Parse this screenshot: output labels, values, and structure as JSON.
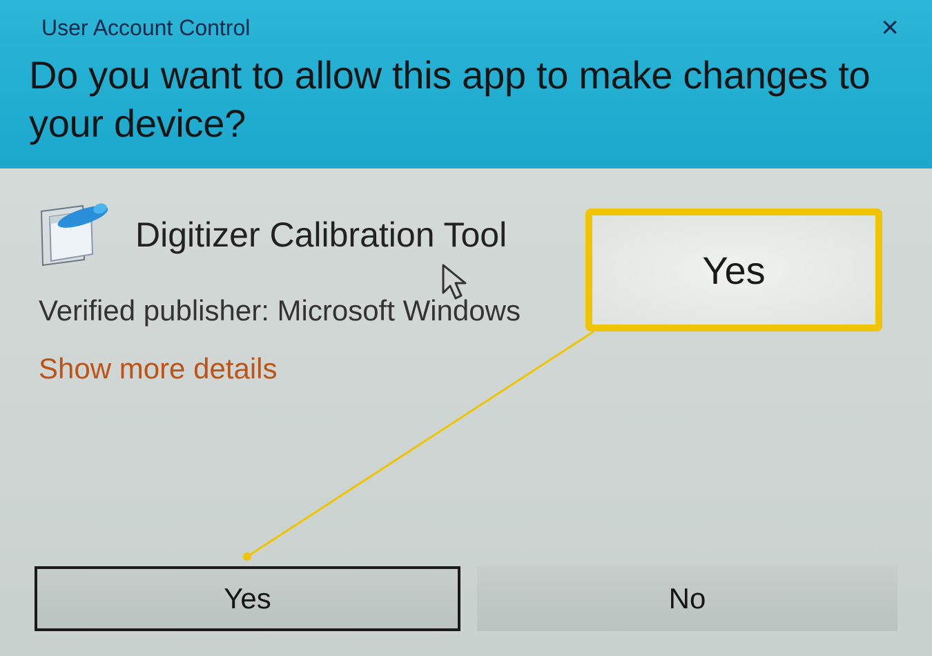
{
  "header": {
    "title": "User Account Control",
    "close_label": "×",
    "question": "Do you want to allow this app to make changes to your device?"
  },
  "body": {
    "app_name": "Digitizer Calibration Tool",
    "publisher_line": "Verified publisher: Microsoft Windows",
    "show_more_label": "Show more details"
  },
  "buttons": {
    "yes_label": "Yes",
    "no_label": "No"
  },
  "callout": {
    "label": "Yes"
  },
  "colors": {
    "header_bg": "#1ba8cc",
    "highlight": "#efc403",
    "link": "#bd5316"
  }
}
